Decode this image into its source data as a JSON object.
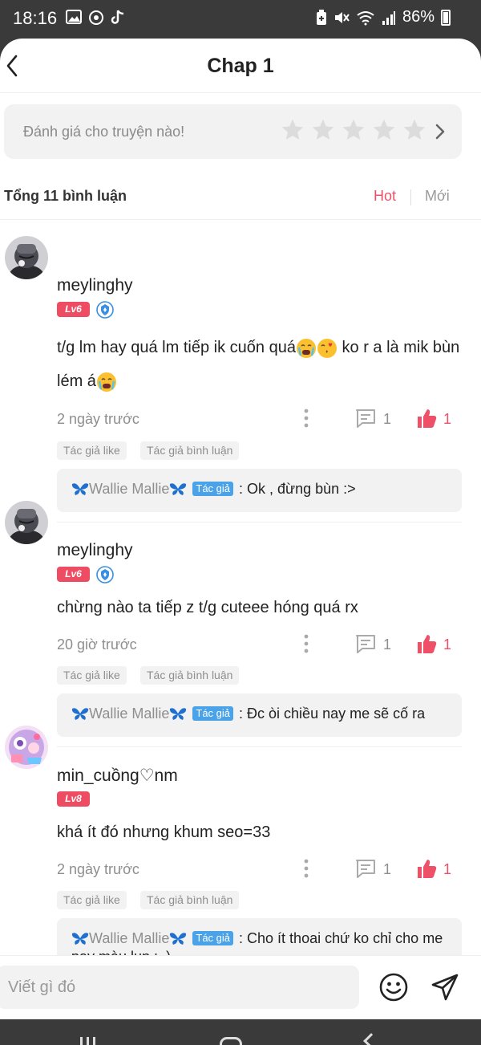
{
  "status_bar": {
    "time": "18:16",
    "battery": "86%",
    "icons": [
      "gallery-icon",
      "camera-app-icon",
      "tiktok-icon",
      "battery-saver-icon",
      "mute-icon",
      "wifi-icon",
      "signal-icon",
      "battery-icon"
    ]
  },
  "header": {
    "title": "Chap 1",
    "back_icon": "back-arrow-icon"
  },
  "rating": {
    "placeholder": "Đánh giá cho truyện nào!",
    "stars": 5,
    "filled": 0
  },
  "comments_header": {
    "total": "Tổng 11 bình luận",
    "sort_hot": "Hot",
    "sort_new": "Mới",
    "active": "Hot"
  },
  "comments": [
    {
      "username": "meylinghy",
      "level": "Lv6",
      "verified": true,
      "text_before": "t/g lm hay quá lm tiếp ik cuốn quá",
      "text_mid": " ko r a là mik bùn lém á",
      "time": "2 ngày trước",
      "replies": "1",
      "likes": "1",
      "tags": [
        "Tác giả like",
        "Tác giả bình luận"
      ],
      "reply": {
        "author": "Wallie Mallie",
        "badge": "Tác giả",
        "text": ": Ok , đừng bùn :>"
      }
    },
    {
      "username": "meylinghy",
      "level": "Lv6",
      "verified": true,
      "text": "chừng nào ta tiếp z t/g cuteee hóng quá rx",
      "time": "20 giờ trước",
      "replies": "1",
      "likes": "1",
      "tags": [
        "Tác giả like",
        "Tác giả bình luận"
      ],
      "reply": {
        "author": "Wallie Mallie",
        "badge": "Tác giả",
        "text": ": Đc òi chiều nay me sẽ cố ra"
      }
    },
    {
      "username": "min_cuồng♡nm",
      "level": "Lv8",
      "verified": false,
      "text": "khá ít đó nhưng khum seo=33",
      "time": "2 ngày trước",
      "replies": "1",
      "likes": "1",
      "tags": [
        "Tác giả like",
        "Tác giả bình luận"
      ],
      "reply": {
        "author": "Wallie Mallie",
        "badge": "Tác giả",
        "text": ": Cho ít thoai chứ ko chỉ cho me pay màu lun :_)"
      }
    }
  ],
  "input": {
    "placeholder": "Viết gì đó",
    "emoji_icon": "emoji-icon",
    "send_icon": "send-icon"
  },
  "colors": {
    "accent": "#ee5068",
    "level_badge": "#ee4c63",
    "author_badge": "#4aa3e8",
    "muted": "#8e8e8e",
    "panel": "#f2f2f2"
  }
}
